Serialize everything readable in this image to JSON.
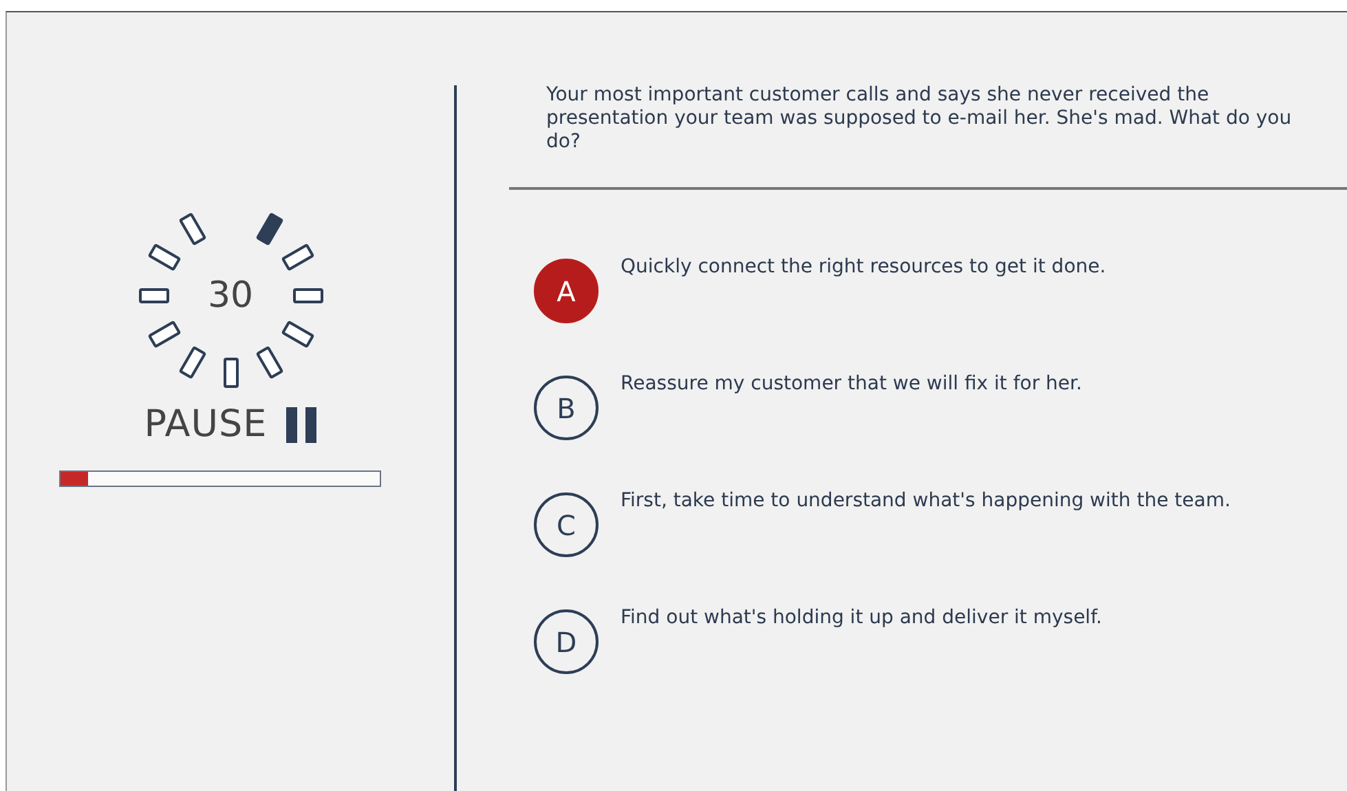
{
  "timer": {
    "seconds": "30",
    "pause_label": "PAUSE",
    "progress": {
      "level": 0.09
    }
  },
  "question": "Your most important customer calls and says she never received the presentation your team was supposed to e-mail her. She's mad. What do you do?",
  "options": [
    {
      "letter": "A",
      "text": "Quickly connect the right resources to get it done.",
      "selected": true
    },
    {
      "letter": "B",
      "text": "Reassure my customer that we will fix it for her.",
      "selected": false
    },
    {
      "letter": "C",
      "text": "First, take time to understand what's happening with the team.",
      "selected": false
    },
    {
      "letter": "D",
      "text": "Find out what's holding it up and deliver it myself.",
      "selected": false
    }
  ]
}
